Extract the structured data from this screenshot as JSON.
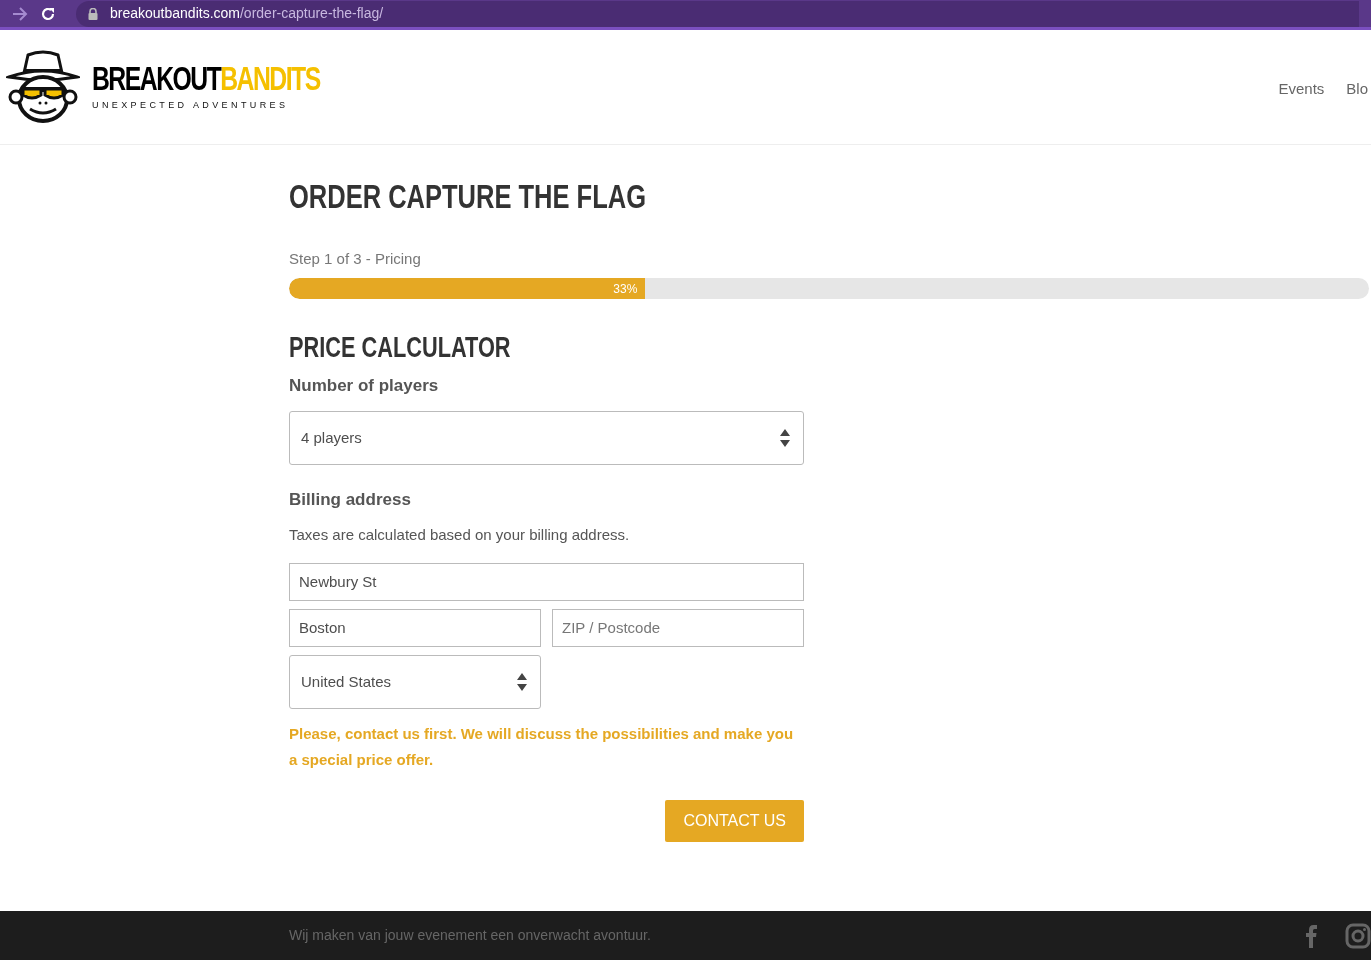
{
  "browser": {
    "url_domain": "breakoutbandits.com",
    "url_path": "/order-capture-the-flag/"
  },
  "header": {
    "logo": {
      "word_1": "BREAKOUT",
      "word_2": "BANDITS",
      "tagline": "UNEXPECTED ADVENTURES"
    },
    "nav": [
      "Events",
      "Blo"
    ]
  },
  "page": {
    "title": "ORDER CAPTURE THE FLAG",
    "step": "Step 1 of 3 - Pricing",
    "progress": {
      "level": 0.33,
      "reading": "33%"
    },
    "section_title": "PRICE CALCULATOR",
    "players": {
      "label": "Number of players",
      "value": "4 players"
    },
    "billing": {
      "label": "Billing address",
      "note": "Taxes are calculated based on your billing address.",
      "street": {
        "value": "Newbury St"
      },
      "city": {
        "value": "Boston"
      },
      "zip": {
        "placeholder": "ZIP / Postcode"
      },
      "country": {
        "value": "United States"
      }
    },
    "notice": "Please, contact us first. We will discuss the possibilities and make you a special price offer.",
    "button": "CONTACT US"
  },
  "footer": {
    "text": "Wij maken van jouw evenement een onverwacht avontuur."
  }
}
